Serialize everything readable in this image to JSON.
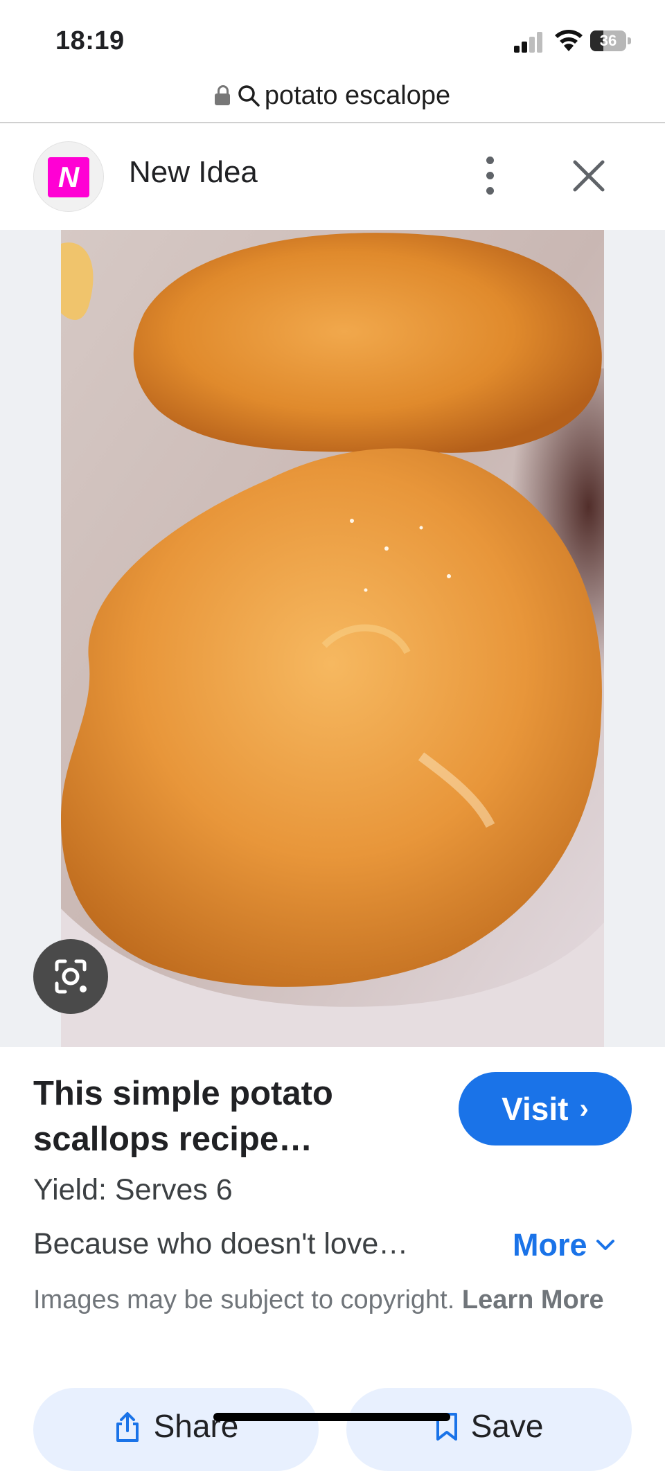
{
  "status_bar": {
    "time": "18:19",
    "battery": "36",
    "battery_level": 0.36
  },
  "url_bar": {
    "query": "potato escalope"
  },
  "source": {
    "logo_letter": "N",
    "name": "New Idea",
    "brand_color": "#ff00d4"
  },
  "result": {
    "title": "This simple potato scallops recipe…",
    "visit_label": "Visit",
    "yield": "Yield: Serves 6",
    "description": "Because who doesn't love…",
    "more_label": "More",
    "copyright_text": "Images may be subject to copyright.",
    "copyright_link": "Learn More"
  },
  "actions": {
    "share_label": "Share",
    "save_label": "Save"
  },
  "colors": {
    "accent": "#1a73e8",
    "chip_bg": "#e8f0fe"
  },
  "icons": {
    "lock": "lock-icon",
    "search": "search-icon",
    "menu": "more-vert-icon",
    "close": "close-icon",
    "lens": "google-lens-icon",
    "share": "share-icon",
    "save": "bookmark-icon"
  }
}
